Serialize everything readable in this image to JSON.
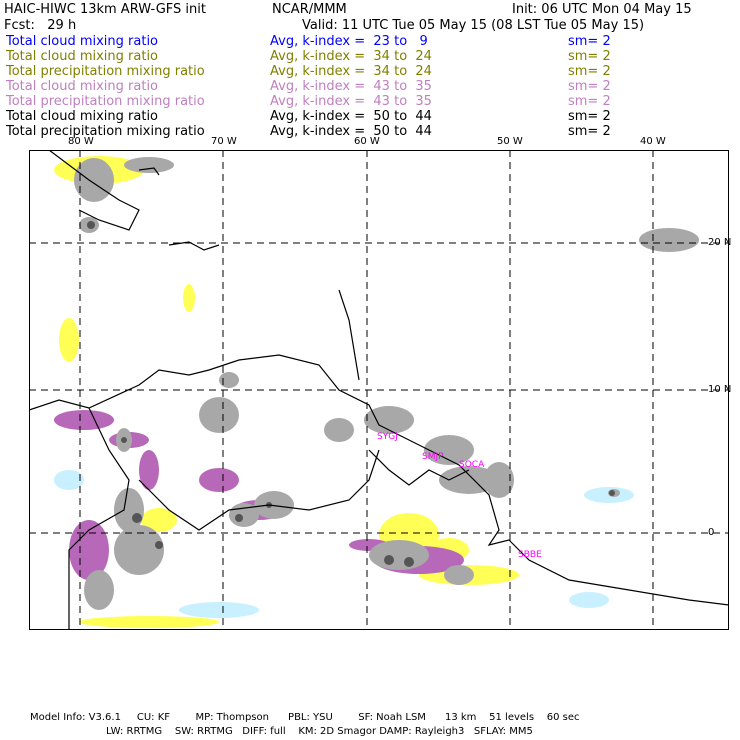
{
  "header": {
    "title": "HAIC-HIWC 13km ARW-GFS init",
    "org": "NCAR/MMM",
    "init": "Init: 06 UTC Mon 04 May 15",
    "fcst": "Fcst:   29 h",
    "valid": "Valid: 11 UTC Tue 05 May 15 (08 LST Tue 05 May 15)"
  },
  "legend": [
    {
      "field": "Total cloud mixing ratio",
      "avg": "Avg, k-index =  23 to   9",
      "sm": "sm= 2",
      "color": "#0000ff"
    },
    {
      "field": "Total cloud mixing ratio",
      "avg": "Avg, k-index =  34 to  24",
      "sm": "sm= 2",
      "color": "#808000"
    },
    {
      "field": "Total precipitation mixing ratio",
      "avg": "Avg, k-index =  34 to  24",
      "sm": "sm= 2",
      "color": "#808000"
    },
    {
      "field": "Total cloud mixing ratio",
      "avg": "Avg, k-index =  43 to  35",
      "sm": "sm= 2",
      "color": "#c080c0"
    },
    {
      "field": "Total precipitation mixing ratio",
      "avg": "Avg, k-index =  43 to  35",
      "sm": "sm= 2",
      "color": "#c080c0"
    },
    {
      "field": "Total cloud mixing ratio",
      "avg": "Avg, k-index =  50 to  44",
      "sm": "sm= 2",
      "color": "#000000"
    },
    {
      "field": "Total precipitation mixing ratio",
      "avg": "Avg, k-index =  50 to  44",
      "sm": "sm= 2",
      "color": "#000000"
    }
  ],
  "map": {
    "lon_labels": [
      "80 W",
      "70 W",
      "60 W",
      "50 W",
      "40 W"
    ],
    "lat_labels": [
      "20 N",
      "10 N",
      "0"
    ],
    "stations": [
      "SYGJ",
      "SMJP",
      "SOCA",
      "SBBE"
    ]
  },
  "footer": {
    "line1": "Model Info: V3.6.1     CU: KF        MP: Thompson      PBL: YSU        SF: Noah LSM      13 km    51 levels    60 sec",
    "line2": "LW: RRTMG    SW: RRTMG   DIFF: full    KM: 2D Smagor DAMP: Rayleigh3   SFLAY: MM5"
  }
}
